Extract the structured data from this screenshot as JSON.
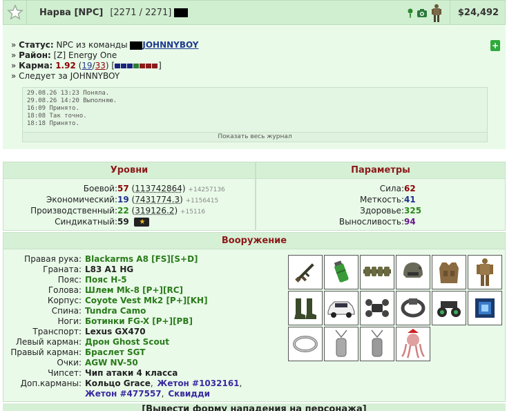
{
  "header": {
    "name": "Нарва [NPC]",
    "hp": "[2271 / 2271]",
    "money": "$24,492",
    "icons": [
      "exclamation-icon",
      "camera-icon",
      "avatar-icon"
    ]
  },
  "status": {
    "status_label": "Статус:",
    "status_text": "NPC из команды",
    "team_name": "JOHNNYBOY",
    "district_label": "Район:",
    "district_text": "[Z] Energy One",
    "karma_label": "Карма:",
    "karma_value": "1.92",
    "karma_a": "19",
    "karma_b": "33",
    "karma_colors": [
      "#1a237e",
      "#1a237e",
      "#1a237e",
      "#2e7d32",
      "#8b1a1a",
      "#8b1a1a",
      "#8b1a1a"
    ],
    "follows": "Следует за JOHNNYBOY",
    "journal": [
      "29.08.26 13:23 Поняла.",
      "29.08.26 14:20 Выполняю.",
      "16:09 Принято.",
      "18:08 Так точно.",
      "18:18 Принято."
    ],
    "journal_link": "Показать весь журнал"
  },
  "levels": {
    "title": "Уровни",
    "rows": [
      {
        "label": "Боевой:",
        "level": "57",
        "exp": "113742864",
        "delta": "+14257136"
      },
      {
        "label": "Экономический:",
        "level": "19",
        "exp": "7431774.3",
        "delta": "+1156415"
      },
      {
        "label": "Производственный:",
        "level": "22",
        "exp": "319126.2",
        "delta": "+15116"
      }
    ],
    "syndicate_label": "Синдикатный:",
    "syndicate_level": "59"
  },
  "params": {
    "title": "Параметры",
    "rows": [
      {
        "label": "Сила:",
        "value": "62"
      },
      {
        "label": "Меткость:",
        "value": "41"
      },
      {
        "label": "Здоровье:",
        "value": "325"
      },
      {
        "label": "Выносливость:",
        "value": "94"
      }
    ]
  },
  "weapons": {
    "title": "Вооружение",
    "rows": [
      {
        "label": "Правая рука:",
        "value": "Blackarms A8 [FS][S+D]"
      },
      {
        "label": "Граната:",
        "value": "L83 A1 HG"
      },
      {
        "label": "Пояс:",
        "value": "Пояс Н-5"
      },
      {
        "label": "Голова:",
        "value": "Шлем Mk-8 [P+][RC]"
      },
      {
        "label": "Корпус:",
        "value": "Coyote Vest Mk2 [P+][KH]"
      },
      {
        "label": "Спина:",
        "value": "Tundra Camo"
      },
      {
        "label": "Ноги:",
        "value": "Ботинки FG-X [P+][PB]"
      },
      {
        "label": "Транспорт:",
        "value": "Lexus GX470"
      },
      {
        "label": "Левый карман:",
        "value": "Дрон Ghost Scout"
      },
      {
        "label": "Правый карман:",
        "value": "Браслет SGT"
      },
      {
        "label": "Очки:",
        "value": "AGW NV-50"
      },
      {
        "label": "Чипсет:",
        "value": "Чип атаки 4 класса"
      }
    ],
    "extra_label": "Доп.карманы:",
    "extra_1": "Кольцо Grace",
    "extra_2": "Жетон #1032161",
    "extra_3": "Жетон #477557",
    "extra_4": "Сквидди",
    "sep": ","
  },
  "footer": {
    "text": "[Вывести форму нападения на персонажа]"
  }
}
